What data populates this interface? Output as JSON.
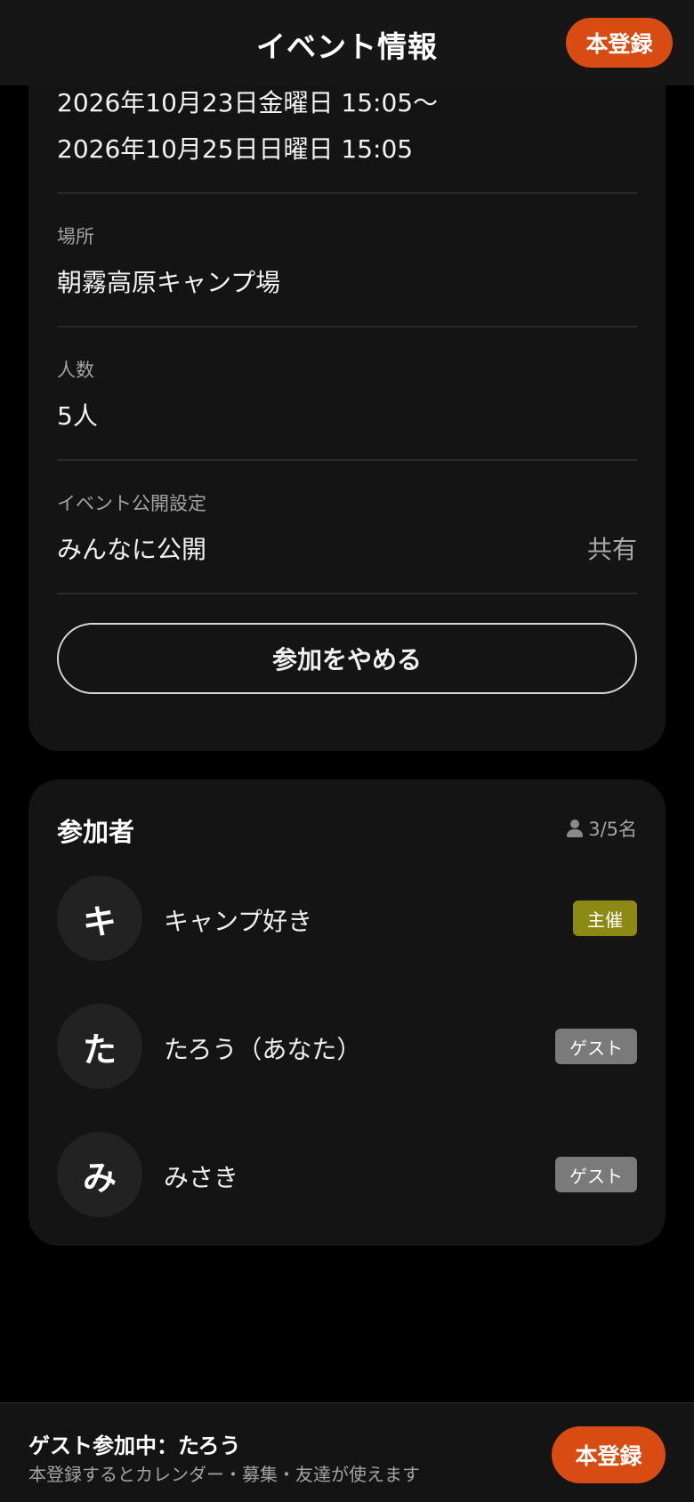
{
  "header": {
    "title": "イベント情報",
    "register_label": "本登録"
  },
  "event": {
    "date_start": "2026年10月23日金曜日 15:05〜",
    "date_end": "2026年10月25日日曜日 15:05",
    "location_label": "場所",
    "location_value": "朝霧高原キャンプ場",
    "capacity_label": "人数",
    "capacity_value": "5人",
    "visibility_label": "イベント公開設定",
    "visibility_value": "みんなに公開",
    "share_label": "共有",
    "leave_label": "参加をやめる"
  },
  "participants": {
    "title": "参加者",
    "count": "3/5名",
    "items": [
      {
        "initial": "キ",
        "name": "キャンプ好き",
        "badge": "主催"
      },
      {
        "initial": "た",
        "name": "たろう（あなた）",
        "badge": "ゲスト"
      },
      {
        "initial": "み",
        "name": "みさき",
        "badge": "ゲスト"
      }
    ]
  },
  "bottom_bar": {
    "title": "ゲスト参加中：たろう",
    "subtitle": "本登録するとカレンダー・募集・友達が使えます",
    "register_label": "本登録"
  },
  "colors": {
    "accent": "#d84b12",
    "host_badge": "#8c8a14",
    "guest_badge": "#7a7a7a"
  }
}
